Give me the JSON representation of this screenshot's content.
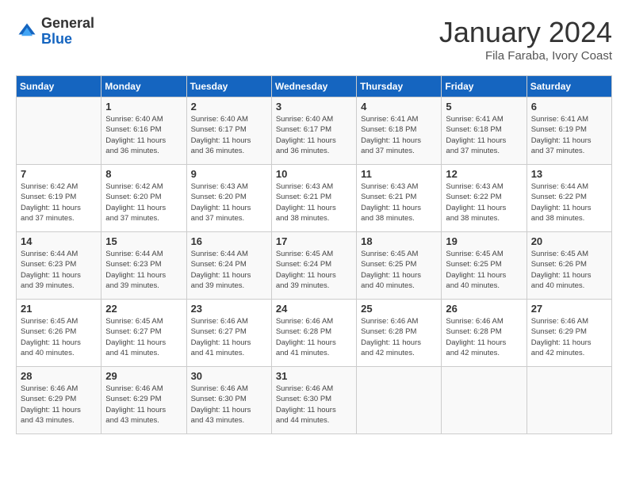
{
  "header": {
    "logo_general": "General",
    "logo_blue": "Blue",
    "month_title": "January 2024",
    "location": "Fila Faraba, Ivory Coast"
  },
  "days_of_week": [
    "Sunday",
    "Monday",
    "Tuesday",
    "Wednesday",
    "Thursday",
    "Friday",
    "Saturday"
  ],
  "weeks": [
    [
      {
        "day": "",
        "info": ""
      },
      {
        "day": "1",
        "info": "Sunrise: 6:40 AM\nSunset: 6:16 PM\nDaylight: 11 hours\nand 36 minutes."
      },
      {
        "day": "2",
        "info": "Sunrise: 6:40 AM\nSunset: 6:17 PM\nDaylight: 11 hours\nand 36 minutes."
      },
      {
        "day": "3",
        "info": "Sunrise: 6:40 AM\nSunset: 6:17 PM\nDaylight: 11 hours\nand 36 minutes."
      },
      {
        "day": "4",
        "info": "Sunrise: 6:41 AM\nSunset: 6:18 PM\nDaylight: 11 hours\nand 37 minutes."
      },
      {
        "day": "5",
        "info": "Sunrise: 6:41 AM\nSunset: 6:18 PM\nDaylight: 11 hours\nand 37 minutes."
      },
      {
        "day": "6",
        "info": "Sunrise: 6:41 AM\nSunset: 6:19 PM\nDaylight: 11 hours\nand 37 minutes."
      }
    ],
    [
      {
        "day": "7",
        "info": "Sunrise: 6:42 AM\nSunset: 6:19 PM\nDaylight: 11 hours\nand 37 minutes."
      },
      {
        "day": "8",
        "info": "Sunrise: 6:42 AM\nSunset: 6:20 PM\nDaylight: 11 hours\nand 37 minutes."
      },
      {
        "day": "9",
        "info": "Sunrise: 6:43 AM\nSunset: 6:20 PM\nDaylight: 11 hours\nand 37 minutes."
      },
      {
        "day": "10",
        "info": "Sunrise: 6:43 AM\nSunset: 6:21 PM\nDaylight: 11 hours\nand 38 minutes."
      },
      {
        "day": "11",
        "info": "Sunrise: 6:43 AM\nSunset: 6:21 PM\nDaylight: 11 hours\nand 38 minutes."
      },
      {
        "day": "12",
        "info": "Sunrise: 6:43 AM\nSunset: 6:22 PM\nDaylight: 11 hours\nand 38 minutes."
      },
      {
        "day": "13",
        "info": "Sunrise: 6:44 AM\nSunset: 6:22 PM\nDaylight: 11 hours\nand 38 minutes."
      }
    ],
    [
      {
        "day": "14",
        "info": "Sunrise: 6:44 AM\nSunset: 6:23 PM\nDaylight: 11 hours\nand 39 minutes."
      },
      {
        "day": "15",
        "info": "Sunrise: 6:44 AM\nSunset: 6:23 PM\nDaylight: 11 hours\nand 39 minutes."
      },
      {
        "day": "16",
        "info": "Sunrise: 6:44 AM\nSunset: 6:24 PM\nDaylight: 11 hours\nand 39 minutes."
      },
      {
        "day": "17",
        "info": "Sunrise: 6:45 AM\nSunset: 6:24 PM\nDaylight: 11 hours\nand 39 minutes."
      },
      {
        "day": "18",
        "info": "Sunrise: 6:45 AM\nSunset: 6:25 PM\nDaylight: 11 hours\nand 40 minutes."
      },
      {
        "day": "19",
        "info": "Sunrise: 6:45 AM\nSunset: 6:25 PM\nDaylight: 11 hours\nand 40 minutes."
      },
      {
        "day": "20",
        "info": "Sunrise: 6:45 AM\nSunset: 6:26 PM\nDaylight: 11 hours\nand 40 minutes."
      }
    ],
    [
      {
        "day": "21",
        "info": "Sunrise: 6:45 AM\nSunset: 6:26 PM\nDaylight: 11 hours\nand 40 minutes."
      },
      {
        "day": "22",
        "info": "Sunrise: 6:45 AM\nSunset: 6:27 PM\nDaylight: 11 hours\nand 41 minutes."
      },
      {
        "day": "23",
        "info": "Sunrise: 6:46 AM\nSunset: 6:27 PM\nDaylight: 11 hours\nand 41 minutes."
      },
      {
        "day": "24",
        "info": "Sunrise: 6:46 AM\nSunset: 6:28 PM\nDaylight: 11 hours\nand 41 minutes."
      },
      {
        "day": "25",
        "info": "Sunrise: 6:46 AM\nSunset: 6:28 PM\nDaylight: 11 hours\nand 42 minutes."
      },
      {
        "day": "26",
        "info": "Sunrise: 6:46 AM\nSunset: 6:28 PM\nDaylight: 11 hours\nand 42 minutes."
      },
      {
        "day": "27",
        "info": "Sunrise: 6:46 AM\nSunset: 6:29 PM\nDaylight: 11 hours\nand 42 minutes."
      }
    ],
    [
      {
        "day": "28",
        "info": "Sunrise: 6:46 AM\nSunset: 6:29 PM\nDaylight: 11 hours\nand 43 minutes."
      },
      {
        "day": "29",
        "info": "Sunrise: 6:46 AM\nSunset: 6:29 PM\nDaylight: 11 hours\nand 43 minutes."
      },
      {
        "day": "30",
        "info": "Sunrise: 6:46 AM\nSunset: 6:30 PM\nDaylight: 11 hours\nand 43 minutes."
      },
      {
        "day": "31",
        "info": "Sunrise: 6:46 AM\nSunset: 6:30 PM\nDaylight: 11 hours\nand 44 minutes."
      },
      {
        "day": "",
        "info": ""
      },
      {
        "day": "",
        "info": ""
      },
      {
        "day": "",
        "info": ""
      }
    ]
  ]
}
